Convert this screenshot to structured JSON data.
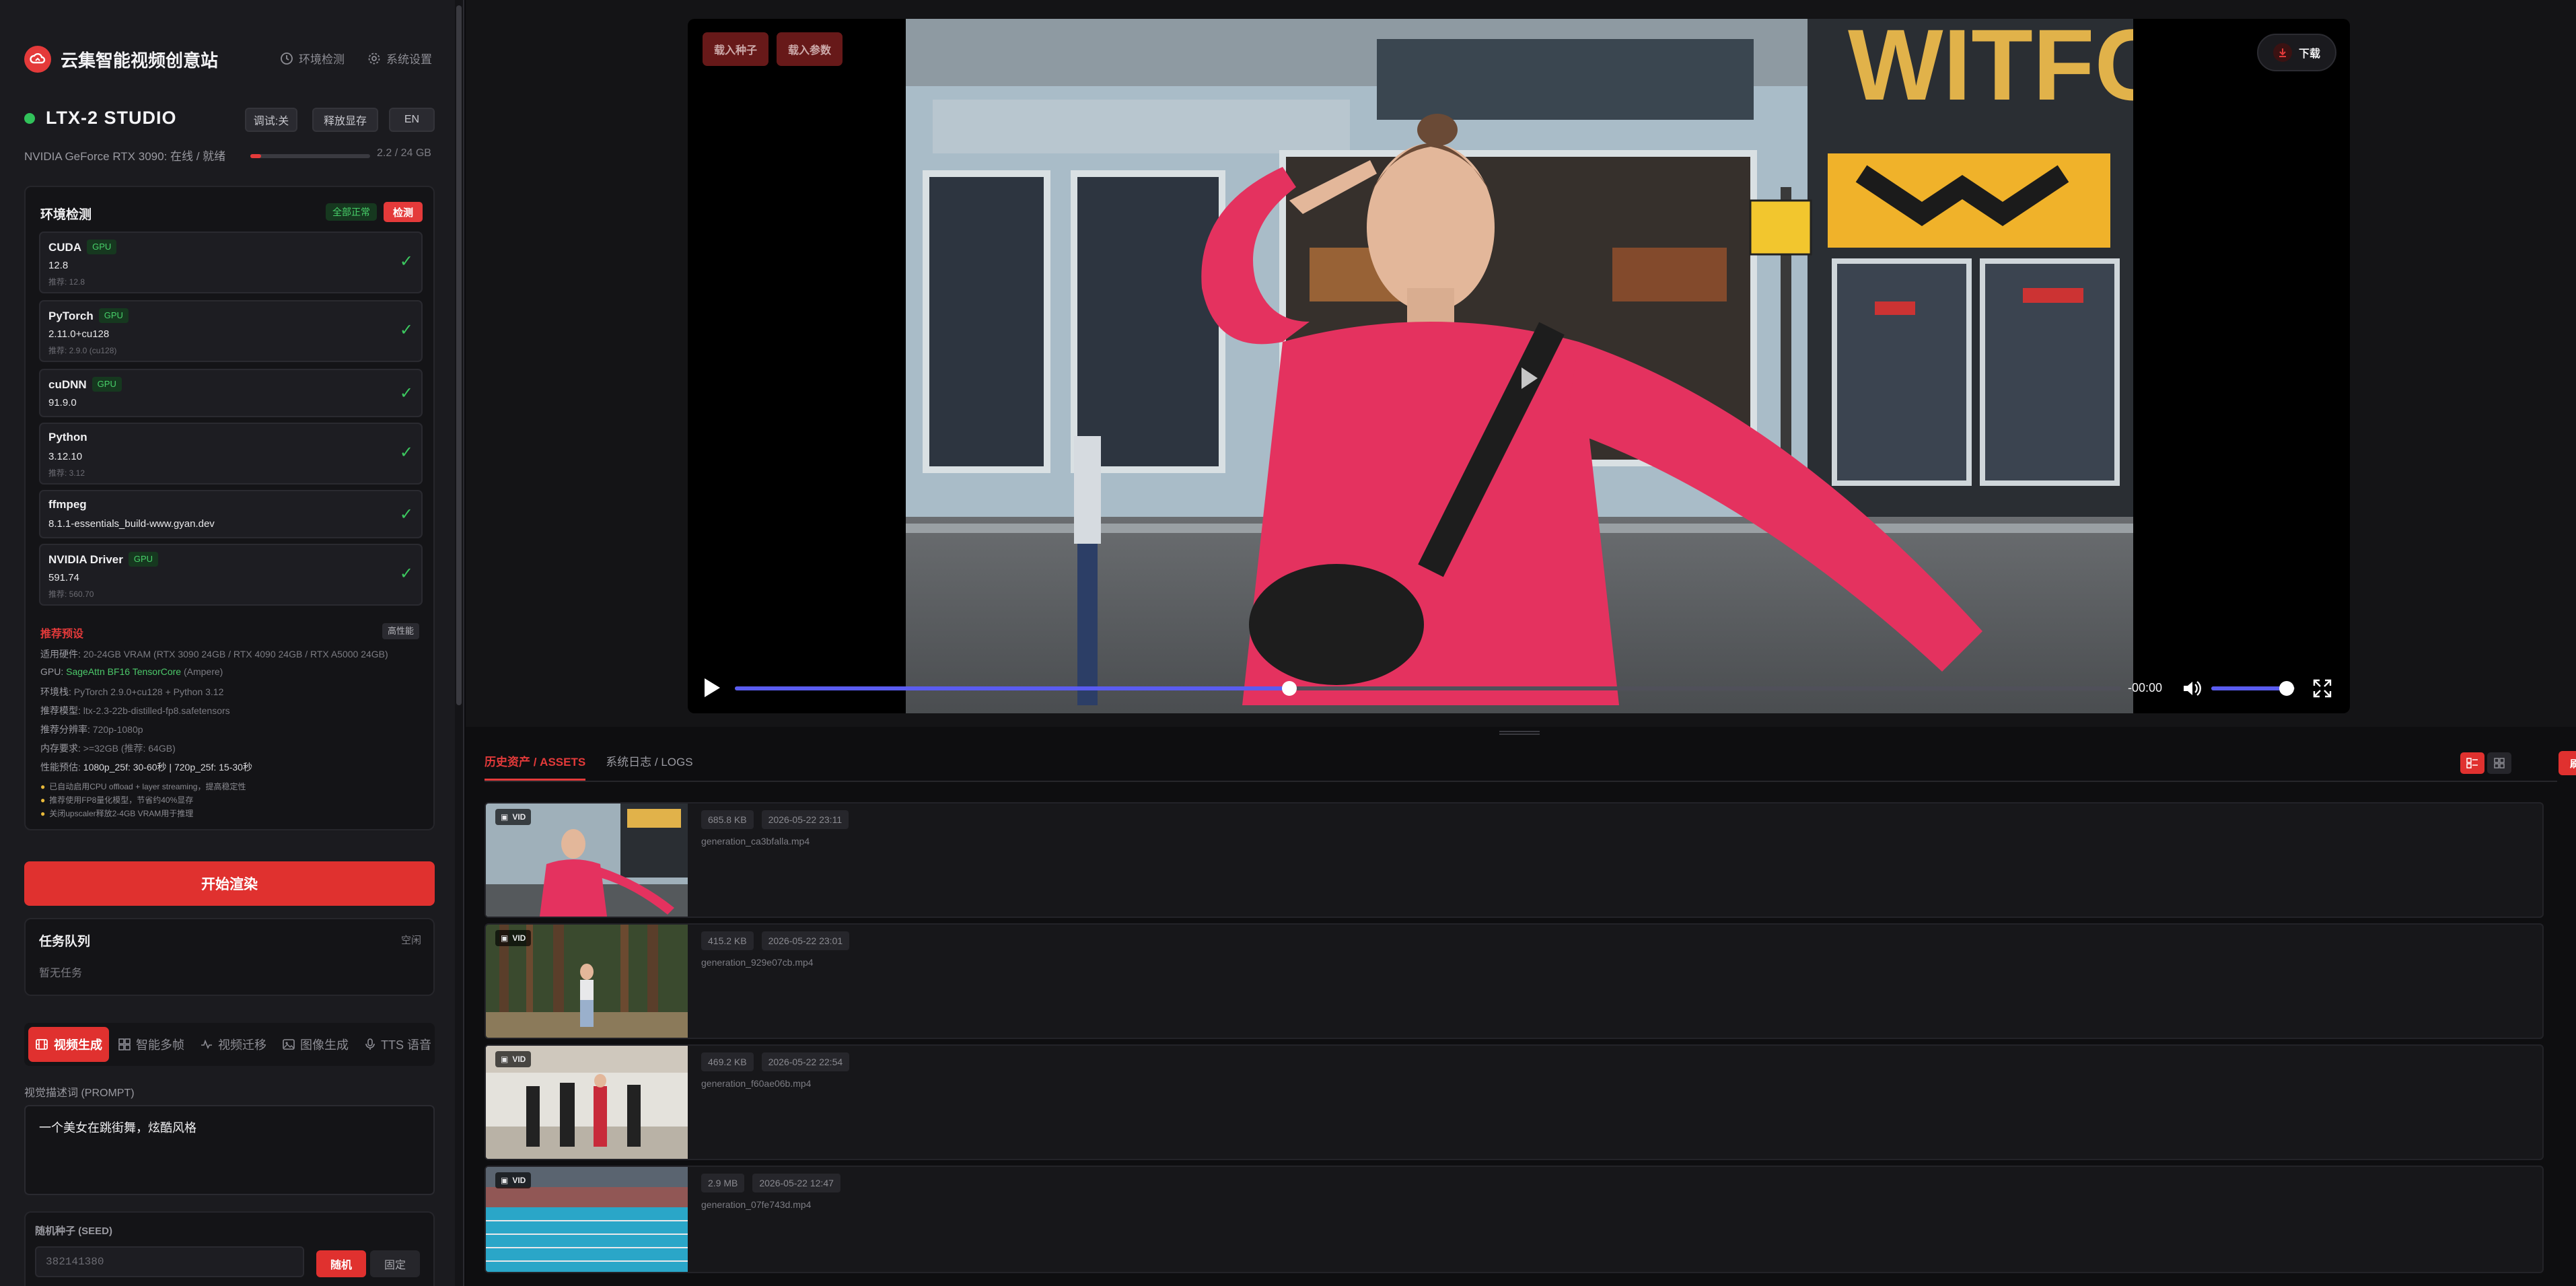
{
  "app": {
    "brand": "云集智能视频创意站",
    "links": {
      "env_check": "环境检测",
      "settings": "系统设置"
    },
    "studio_name": "LTX-2 STUDIO",
    "debug_btn": "调试:关",
    "release_btn": "释放显存",
    "lang_btn": "EN",
    "gpu_status": "NVIDIA GeForce RTX 3090: 在线 / 就绪",
    "vram_text": "2.2 / 24 GB",
    "vram_fraction": 0.09
  },
  "env": {
    "title": "环境检测",
    "all_ok": "全部正常",
    "check_btn": "检测",
    "items": [
      {
        "name": "CUDA",
        "gpu": "GPU",
        "version": "12.8",
        "rec": "推荐: 12.8"
      },
      {
        "name": "PyTorch",
        "gpu": "GPU",
        "version": "2.11.0+cu128",
        "rec": "推荐: 2.9.0 (cu128)"
      },
      {
        "name": "cuDNN",
        "gpu": "GPU",
        "version": "91.9.0",
        "rec": ""
      },
      {
        "name": "Python",
        "gpu": "",
        "version": "3.12.10",
        "rec": "推荐: 3.12"
      },
      {
        "name": "ffmpeg",
        "gpu": "",
        "version": "8.1.1-essentials_build-www.gyan.dev",
        "rec": ""
      },
      {
        "name": "NVIDIA Driver",
        "gpu": "GPU",
        "version": "591.74",
        "rec": "推荐: 560.70"
      }
    ],
    "rec_title": "推荐预设",
    "rec_tag": "高性能",
    "rec": {
      "hw_label": "适用硬件:",
      "hw": "20-24GB VRAM (RTX 3090 24GB / RTX 4090 24GB / RTX A5000 24GB)",
      "gpu_label": "GPU:",
      "gpu": "SageAttn BF16 TensorCore",
      "gpu_suffix": "(Ampere)",
      "stack_label": "环境栈:",
      "stack": "PyTorch 2.9.0+cu128 + Python 3.12",
      "model_label": "推荐模型:",
      "model": "ltx-2.3-22b-distilled-fp8.safetensors",
      "res_label": "推荐分辨率:",
      "res": "720p-1080p",
      "mem_label": "内存要求:",
      "mem": ">=32GB (推荐: 64GB)",
      "perf_label": "性能预估:",
      "perf": "1080p_25f: 30-60秒 | 720p_25f: 15-30秒"
    },
    "tips": [
      "已自动启用CPU offload + layer streaming，提高稳定性",
      "推荐使用FP8量化模型，节省约40%显存",
      "关闭upscaler释放2-4GB VRAM用于推理"
    ]
  },
  "start_btn": "开始渲染",
  "queue": {
    "title": "任务队列",
    "status": "空闲",
    "empty": "暂无任务"
  },
  "mode_tabs": [
    "视频生成",
    "智能多帧",
    "视频迁移",
    "图像生成",
    "TTS 语音"
  ],
  "prompt": {
    "label": "视觉描述词 (PROMPT)",
    "value": "一个美女在跳街舞，炫酷风格"
  },
  "seed": {
    "label": "随机种子 (SEED)",
    "value": "382141380",
    "random_btn": "随机",
    "fixed_btn": "固定"
  },
  "player": {
    "load_seed": "载入种子",
    "load_params": "载入参数",
    "download": "下载",
    "time": "-00:00",
    "progress": 0.4,
    "volume": 0.9,
    "sign_text": "WITFC"
  },
  "tabs": {
    "assets": "历史资产 / ASSETS",
    "logs": "系统日志 / LOGS",
    "refresh": "刷新"
  },
  "assets": [
    {
      "tag": "VID",
      "size": "685.8 KB",
      "date": "2026-05-22 23:11",
      "file": "generation_ca3bfalla.mp4"
    },
    {
      "tag": "VID",
      "size": "415.2 KB",
      "date": "2026-05-22 23:01",
      "file": "generation_929e07cb.mp4"
    },
    {
      "tag": "VID",
      "size": "469.2 KB",
      "date": "2026-05-22 22:54",
      "file": "generation_f60ae06b.mp4"
    },
    {
      "tag": "VID",
      "size": "2.9 MB",
      "date": "2026-05-22 12:47",
      "file": "generation_07fe743d.mp4"
    }
  ],
  "colors": {
    "accent": "#e0312f",
    "ok": "#3cc85f",
    "progress": "#5a5cf0"
  }
}
